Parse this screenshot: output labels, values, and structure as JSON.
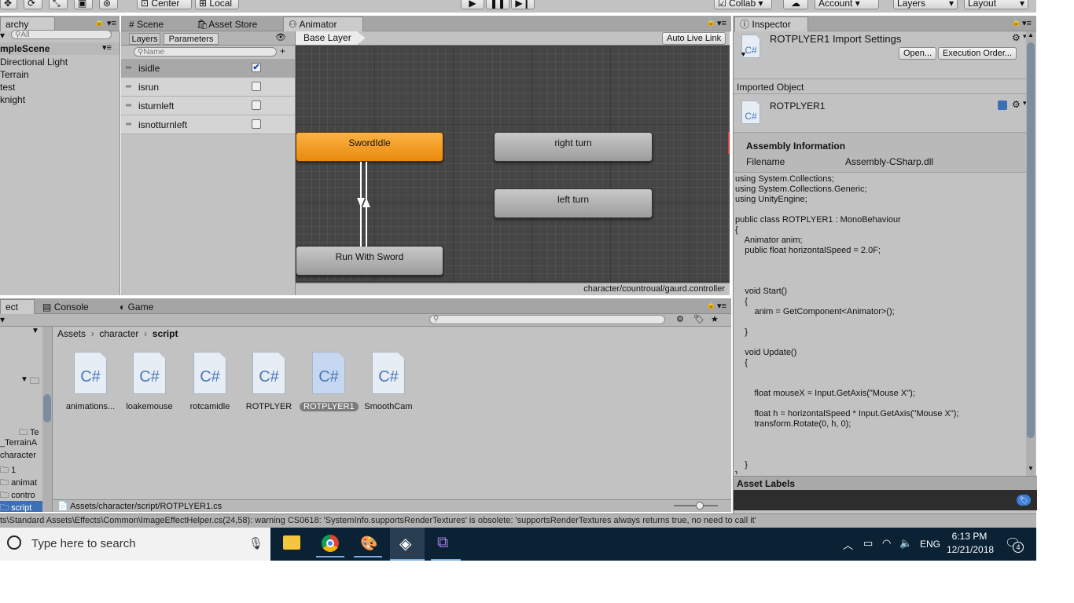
{
  "toolbar": {
    "center": "Center",
    "local": "Local",
    "collab": "Collab",
    "account": "Account",
    "layers": "Layers",
    "layout": "Layout"
  },
  "hierarchy": {
    "tab": "archy",
    "search_placeholder": "All",
    "scene": "mpleScene",
    "items": [
      "Directional Light",
      "Terrain",
      "test",
      "knight"
    ]
  },
  "center_tabs": {
    "scene": "Scene",
    "asset_store": "Asset Store",
    "animator": "Animator"
  },
  "animator": {
    "subtab_layers": "Layers",
    "subtab_parameters": "Parameters",
    "name_placeholder": "Name",
    "base_layer": "Base Layer",
    "auto_live_link": "Auto Live Link",
    "parameters": [
      {
        "name": "isidle",
        "checked": true
      },
      {
        "name": "isrun",
        "checked": false
      },
      {
        "name": "isturnleft",
        "checked": false
      },
      {
        "name": "isnotturnleft",
        "checked": false
      }
    ],
    "states": {
      "sword_idle": "SwordIdle",
      "right_turn": "right turn",
      "left_turn": "left turn",
      "run_with_sword": "Run With Sword"
    },
    "controller_path": "character/countroual/gaurd.controller"
  },
  "bottom_tabs": {
    "project": "ect",
    "console": "Console",
    "game": "Game"
  },
  "project": {
    "breadcrumb": [
      "Assets",
      "character",
      "script"
    ],
    "tree": [
      "Te",
      "_TerrainA",
      "character",
      "1",
      "animat",
      "contro",
      "script"
    ],
    "assets": [
      {
        "label": "animations...",
        "selected": false
      },
      {
        "label": "loakemouse",
        "selected": false
      },
      {
        "label": "rotcamidle",
        "selected": false
      },
      {
        "label": "ROTPLYER",
        "selected": false
      },
      {
        "label": "ROTPLYER1",
        "selected": true
      },
      {
        "label": "SmoothCam",
        "selected": false
      }
    ],
    "status_path": "Assets/character/script/ROTPLYER1.cs"
  },
  "inspector": {
    "tab": "Inspector",
    "title": "ROTPLYER1 Import Settings",
    "open": "Open...",
    "execution_order": "Execution Order...",
    "imported_object": "Imported Object",
    "object_name": "ROTPLYER1",
    "assembly_info": "Assembly Information",
    "filename_label": "Filename",
    "filename_value": "Assembly-CSharp.dll",
    "code": "using System.Collections;\nusing System.Collections.Generic;\nusing UnityEngine;\n\npublic class ROTPLYER1 : MonoBehaviour\n{\n    Animator anim;\n    public float horizontalSpeed = 2.0F;\n\n\n\n    void Start()\n    {\n        anim = GetComponent<Animator>();\n\n    }\n\n    void Update()\n    {\n\n\n        float mouseX = Input.GetAxis(\"Mouse X\");\n\n        float h = horizontalSpeed * Input.GetAxis(\"Mouse X\");\n        transform.Rotate(0, h, 0);\n\n\n\n    }\n}",
    "asset_labels": "Asset Labels"
  },
  "console_message": "ts\\Standard Assets\\Effects\\Common\\ImageEffectHelper.cs(24,58): warning CS0618: 'SystemInfo.supportsRenderTextures' is obsolete: 'supportsRenderTextures always returns true, no need to call it'",
  "taskbar": {
    "search_placeholder": "Type here to search",
    "lang": "ENG",
    "time": "6:13 PM",
    "date": "12/21/2018",
    "notifications": "4"
  },
  "colors": {
    "panel": "#c2c2c2",
    "graph_bg": "#454545",
    "state_orange": "#f39c1f",
    "taskbar": "#0b2235",
    "accent_blue": "#4a78b8"
  }
}
